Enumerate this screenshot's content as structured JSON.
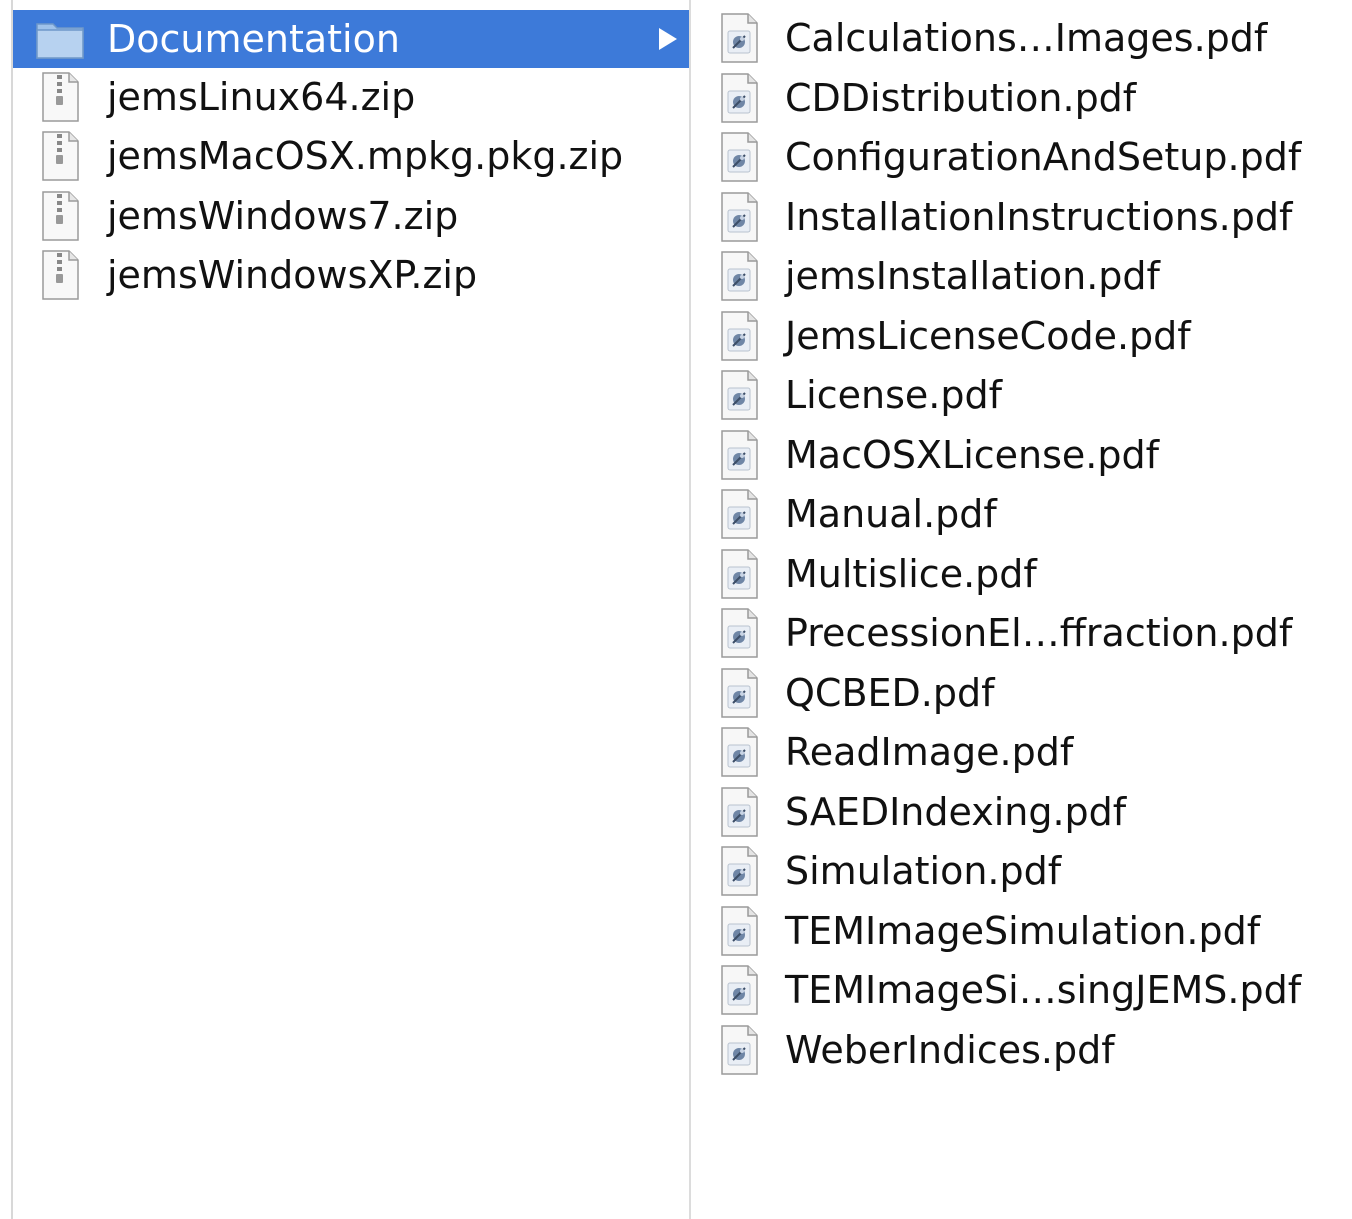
{
  "left_column": {
    "items": [
      {
        "label": "Documentation",
        "icon": "folder-icon",
        "selected": true
      },
      {
        "label": "jemsLinux64.zip",
        "icon": "zip-file-icon",
        "selected": false
      },
      {
        "label": "jemsMacOSX.mpkg.pkg.zip",
        "icon": "zip-file-icon",
        "selected": false
      },
      {
        "label": "jemsWindows7.zip",
        "icon": "zip-file-icon",
        "selected": false
      },
      {
        "label": "jemsWindowsXP.zip",
        "icon": "zip-file-icon",
        "selected": false
      }
    ]
  },
  "right_column": {
    "items": [
      {
        "label": "Calculations…Images.pdf",
        "icon": "pdf-file-icon"
      },
      {
        "label": "CDDistribution.pdf",
        "icon": "pdf-file-icon"
      },
      {
        "label": "ConfigurationAndSetup.pdf",
        "icon": "pdf-file-icon"
      },
      {
        "label": "InstallationInstructions.pdf",
        "icon": "pdf-file-icon"
      },
      {
        "label": "jemsInstallation.pdf",
        "icon": "pdf-file-icon"
      },
      {
        "label": "JemsLicenseCode.pdf",
        "icon": "pdf-file-icon"
      },
      {
        "label": "License.pdf",
        "icon": "pdf-file-icon"
      },
      {
        "label": "MacOSXLicense.pdf",
        "icon": "pdf-file-icon"
      },
      {
        "label": "Manual.pdf",
        "icon": "pdf-file-icon"
      },
      {
        "label": "Multislice.pdf",
        "icon": "pdf-file-icon"
      },
      {
        "label": "PrecessionEl…ffraction.pdf",
        "icon": "pdf-file-icon"
      },
      {
        "label": "QCBED.pdf",
        "icon": "pdf-file-icon"
      },
      {
        "label": "ReadImage.pdf",
        "icon": "pdf-file-icon"
      },
      {
        "label": "SAEDIndexing.pdf",
        "icon": "pdf-file-icon"
      },
      {
        "label": "Simulation.pdf",
        "icon": "pdf-file-icon"
      },
      {
        "label": "TEMImageSimulation.pdf",
        "icon": "pdf-file-icon"
      },
      {
        "label": "TEMImageSi…singJEMS.pdf",
        "icon": "pdf-file-icon"
      },
      {
        "label": "WeberIndices.pdf",
        "icon": "pdf-file-icon"
      }
    ]
  },
  "colors": {
    "selection": "#3d7ad9",
    "text": "#111111",
    "selected_text": "#ffffff"
  }
}
